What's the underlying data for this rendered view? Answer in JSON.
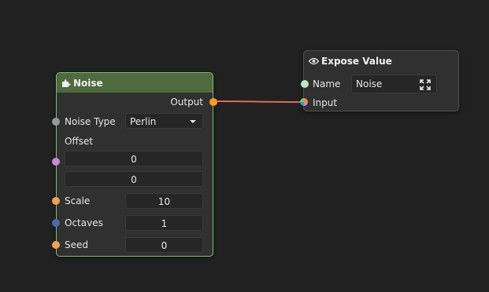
{
  "colors": {
    "background": "#212121",
    "node_body": "#303030",
    "noise_header": "#4e6a3e",
    "noise_border": "#7fb87a",
    "wire": "#e06a5a",
    "port_gray": "#9a9a9a",
    "port_purple": "#c58ad6",
    "port_orange": "#f0a050",
    "port_blue": "#4a6ab0",
    "port_output": "#ff9a1f",
    "port_name": "#bfe3c0"
  },
  "noise_node": {
    "title": "Noise",
    "icon": "puzzle-piece-icon",
    "output_label": "Output",
    "noise_type": {
      "label": "Noise Type",
      "value": "Perlin"
    },
    "offset": {
      "label": "Offset",
      "x": "0",
      "y": "0"
    },
    "scale": {
      "label": "Scale",
      "value": "10"
    },
    "octaves": {
      "label": "Octaves",
      "value": "1"
    },
    "seed": {
      "label": "Seed",
      "value": "0"
    }
  },
  "expose_node": {
    "title": "Expose Value",
    "icon": "eye-icon",
    "name_label": "Name",
    "name_value": "Noise",
    "input_label": "Input",
    "expand_icon": "expand-icon"
  }
}
